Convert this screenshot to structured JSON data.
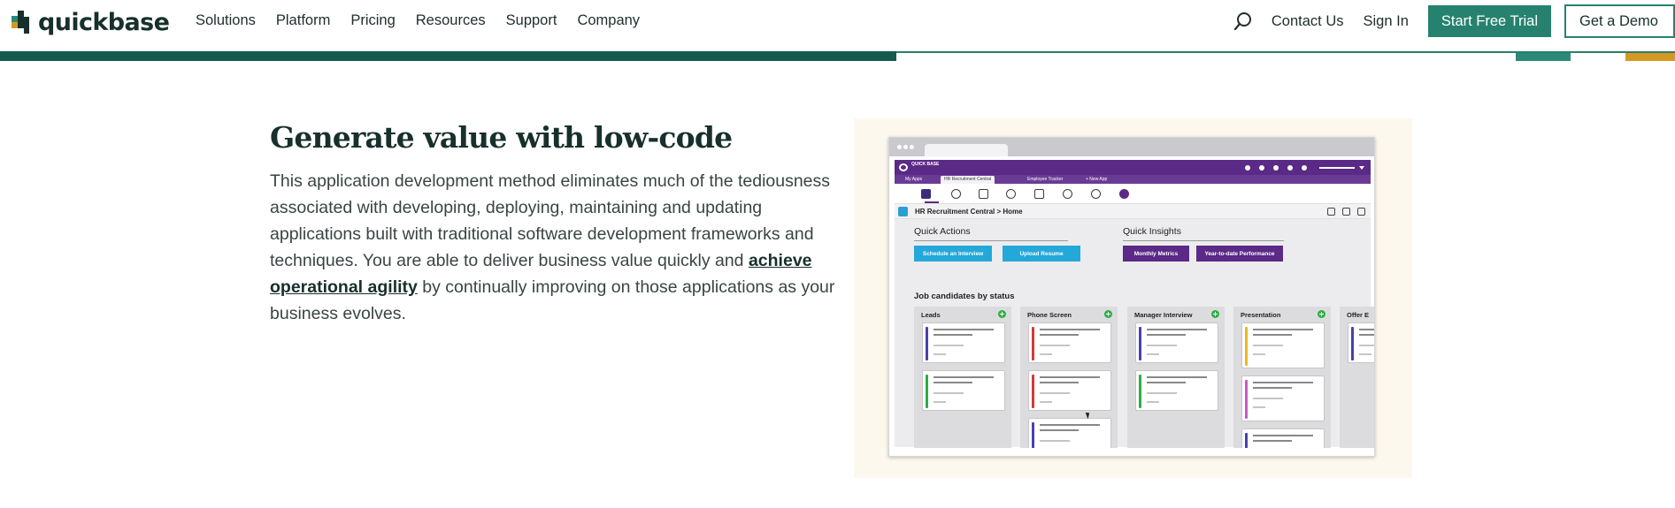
{
  "nav": {
    "logo_text": "quickbase",
    "links": [
      "Solutions",
      "Platform",
      "Pricing",
      "Resources",
      "Support",
      "Company"
    ],
    "contact_label": "Contact Us",
    "signin_label": "Sign In",
    "trial_label": "Start Free Trial",
    "demo_label": "Get a Demo"
  },
  "hero": {
    "heading": "Generate value with low-code",
    "body_before_link": "This application development method eliminates much of the tediousness associated with developing, deploying, maintaining and updating applications built with traditional software development frameworks and techniques. You are able to deliver business value quickly and ",
    "link_text": "achieve operational agility",
    "body_after_link": " by continually improving on those applications as your business evolves."
  },
  "illustration": {
    "app_logo_text": "QUICK BASE",
    "tabs": [
      "My Apps",
      "HR Recruitment Central",
      "Employee Tracker",
      "+ New App"
    ],
    "breadcrumb": "HR Recruitment Central  >  Home",
    "quick_actions": {
      "title": "Quick Actions",
      "buttons": [
        "Schedule an Interview",
        "Upload Resume"
      ]
    },
    "quick_insights": {
      "title": "Quick Insights",
      "buttons": [
        "Monthly Metrics",
        "Year-to-date Performance"
      ]
    },
    "board_title": "Job candidates by status",
    "columns": [
      {
        "title": "Leads",
        "cards": [
          "#4a3fb0",
          "#2cae45"
        ]
      },
      {
        "title": "Phone Screen",
        "cards": [
          "#d33a3a",
          "#d33a3a",
          "#4a3fb0"
        ]
      },
      {
        "title": "Manager Interview",
        "cards": [
          "#4a3fb0",
          "#2cae45"
        ]
      },
      {
        "title": "Presentation",
        "cards": [
          "#e8b923",
          "#c759c9",
          "#4a3fb0"
        ]
      },
      {
        "title": "Offer E",
        "cards": [
          "#4a3fb0"
        ]
      }
    ]
  },
  "colors": {
    "brand_green": "#26826f",
    "brand_dark": "#17302b",
    "app_purple": "#5a2a86",
    "accent_teal": "#24a8d9",
    "accent_gold": "#d39a22"
  }
}
